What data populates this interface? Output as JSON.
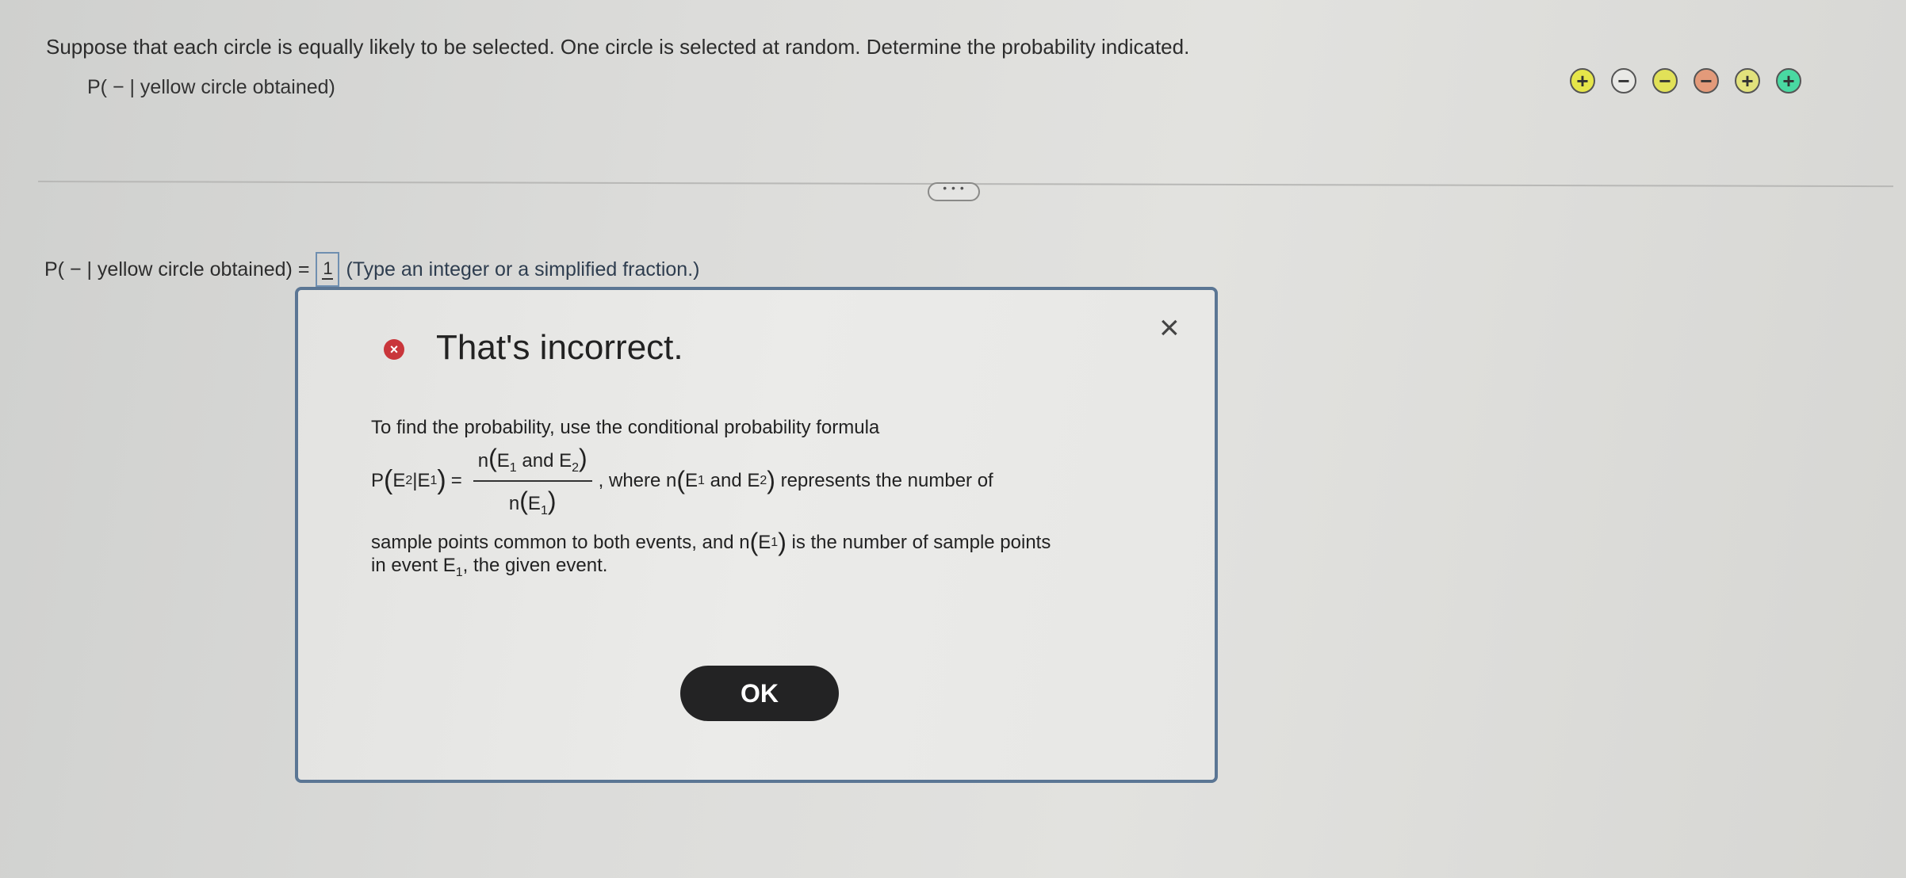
{
  "question": {
    "text": "Suppose that each circle is equally likely to be selected. One circle is selected at random. Determine the probability indicated.",
    "prompt": "P( − | yellow circle obtained)"
  },
  "circles": [
    {
      "symbol": "+",
      "color": "#e6e64a"
    },
    {
      "symbol": "−",
      "color": "#e9e9e6"
    },
    {
      "symbol": "−",
      "color": "#e1e158"
    },
    {
      "symbol": "−",
      "color": "#e39a7a"
    },
    {
      "symbol": "+",
      "color": "#e2e27c"
    },
    {
      "symbol": "+",
      "color": "#49d9a2"
    }
  ],
  "more_label": "• • •",
  "answer": {
    "prefix": "P( − | yellow circle obtained) =",
    "numerator": "1",
    "hint": "(Type an integer or a simplified fraction.)"
  },
  "feedback": {
    "close": "×",
    "icon": "×",
    "title": "That's incorrect.",
    "line1": "To find the probability, use the conditional probability formula",
    "formula_lhs_pre": "P",
    "formula_lhs_e2": "E",
    "formula_lhs_e2_sub": "2",
    "formula_lhs_mid": "|E",
    "formula_lhs_e1_sub": "1",
    "formula_eq": "=",
    "numerator_pre": "n",
    "numerator_e1": "E",
    "numerator_and": "and E",
    "denominator_pre": "n",
    "denominator_e": "E",
    "sub_1": "1",
    "sub_2": "2",
    "after_formula_1": ", where n",
    "after_formula_2": "and E",
    "after_formula_3": "represents the number of",
    "line3_a": "sample points common to both events, and n",
    "line3_b": "is the number of sample points",
    "line4_a": "in event E",
    "line4_b": ", the given event.",
    "ok_label": "OK"
  }
}
